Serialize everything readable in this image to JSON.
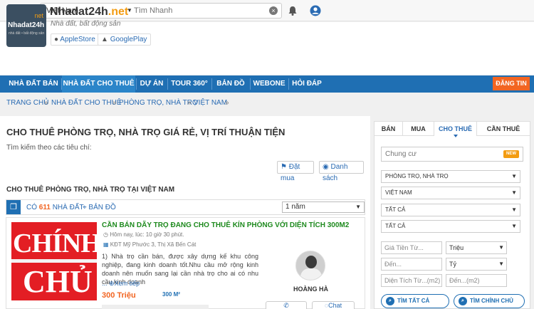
{
  "topbar": {
    "country": "Việt Nam",
    "search_placeholder": "Tìm Nhanh"
  },
  "brand": {
    "logo_net": "net",
    "logo_name": "Nhadat24h",
    "logo_sub": "nhà đất • bất động sản",
    "name": "Nhadat24h",
    "name_suffix": ".net",
    "tagline": "Nhà đất, bất động sản",
    "apple": "AppleStore",
    "google": "GooglePlay"
  },
  "nav": {
    "items": [
      "NHÀ ĐẤT BÁN",
      "NHÀ ĐẤT CHO THUÊ",
      "DỰ ÁN",
      "TOUR 360°",
      "BẢN ĐỒ",
      "WEBONE",
      "HỎI ĐÁP"
    ],
    "post_button": "ĐĂNG TIN"
  },
  "breadcrumb": [
    "TRANG CHỦ",
    "NHÀ ĐẤT CHO THUÊ",
    "PHÒNG TRỌ, NHÀ TRỌ",
    "VIỆT NAM"
  ],
  "main": {
    "title": "CHO THUÊ PHÒNG TRỌ, NHÀ TRỌ GIÁ RẺ, VỊ TRÍ THUẬN TIỆN",
    "subtitle": "Tìm kiếm theo các tiêu chí:",
    "btn_buy": "Đặt mua",
    "btn_list": "Danh sách",
    "section_title": "CHO THUÊ PHÒNG TRỌ, NHÀ TRỌ TẠI VIỆT NAM",
    "count_prefix": "CÓ",
    "count": "611",
    "count_suffix": "NHÀ ĐẤT",
    "map_link": "BẢN ĐỒ",
    "sort": "1 năm"
  },
  "listing": {
    "thumb_word1": "CHÍNH",
    "thumb_word2": "CHỦ",
    "title": "CẦN BÁN DÃY TRỌ ĐANG CHO THUÊ KÍN PHÒNG VỚI DIỆN TÍCH 300M2",
    "time": "Hôm nay, lúc: 10 giờ 30 phút.",
    "location": "KĐT Mỹ Phước 3, Thị Xã Bến Cát",
    "desc": "1) Nhà trọ cần bán, được xây dựng kế khu công nghiệp, đang kinh doanh tốt.Nhu cầu mở rộng kinh doanh nên muốn sang lại cần nhà trọ cho ai có nhu cầu kinh doanh",
    "more": "Xem tiếp",
    "more_prefix": "...",
    "price": "300 Triệu",
    "area": "300 M²",
    "user": "HOÀNG HÀ",
    "chat": "Chat"
  },
  "side": {
    "tabs": [
      "BÁN",
      "MUA",
      "CHO THUÊ",
      "CẦN THUÊ"
    ],
    "keyword": "Chung cư",
    "new_badge": "NEW",
    "type": "PHÒNG TRỌ, NHÀ TRỌ",
    "country": "VIỆT NAM",
    "all1": "TẤT CẢ",
    "all2": "TẤT CẢ",
    "price_from": "Giá Tiền Từ...",
    "price_unit1": "Triệu",
    "to": "Đến...",
    "price_unit2": "Tỷ",
    "area_from": "Diện Tích Từ...(m2)",
    "area_to": "Đến...(m2)",
    "btn_all": "TÌM TẤT CẢ",
    "btn_owner": "TÌM CHÍNH CHỦ"
  }
}
